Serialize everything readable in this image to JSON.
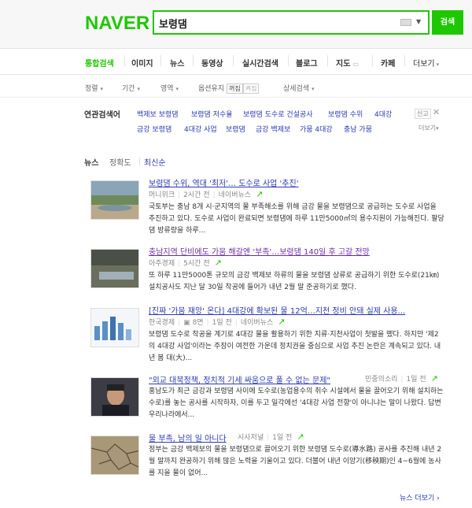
{
  "header": {
    "logo": "NAVER",
    "query": "보령댐",
    "search_button": "검색"
  },
  "tabs": [
    "통합검색",
    "이미지",
    "뉴스",
    "동영상",
    "실시간검색",
    "블로그",
    "지도",
    "카페",
    "더보기"
  ],
  "filters": {
    "sort": "정렬",
    "period": "기간",
    "area": "영역",
    "option_keep": "옵션유지",
    "toggle_on": "꺼짐",
    "toggle_off": "켜짐",
    "detail": "상세검색"
  },
  "related": {
    "title": "연관검색어",
    "report": "신고",
    "more": "더보기",
    "row1": [
      "백제보 보령댐",
      "보령댐 저수율",
      "보령댐 도수로 건설공사",
      "보령댐 수위",
      "4대강"
    ],
    "row2": [
      "금강 보령댐",
      "4대강 사업",
      "보령댐",
      "금강 백제보",
      "가뭄 4대강",
      "충남 가뭄"
    ]
  },
  "sort_tabs": [
    "뉴스",
    "정확도",
    "최신순"
  ],
  "news": [
    {
      "title": "보령댐 수위, 역대 '최저'… 도수로 사업 '추진'",
      "source": "머니위크",
      "time": "2시간 전",
      "link": "네이버뉴스",
      "snippet": "국토부는 충남 8개 시·군지역의 물 부족해소를 위해 금강 물을 보령댐으로 공급하는 도수로 사업을 추진하고 있다. 도수로 사업이 완료되면 보령댐에 하루 11만5000㎥의 용수지원이 가능해진다. 팔당댐 방류량을 하루..."
    },
    {
      "title": "충남지역 단비에도 가뭄 해갈엔 '부족'…보령댐 140일 후 고갈 전망",
      "source": "아주경제",
      "time": "5시간 전",
      "link": "",
      "snippet": "또 하루 11만5000톤 규모의 금강 백제보 하류의 물을 보령댐 상류로 공급하기 위한 도수로(21㎞) 설치공사도 지난 달 30일 착공에 들어가 내년 2월 말 준공하기로 했다."
    },
    {
      "title": "[진짜 '가뭄 재앙' 온다] 4대강에 확보된 물 12억…지천 정비 안돼 실제 사용...",
      "source": "한국경제",
      "extra": "8면",
      "time": "1일 전",
      "link": "네이버뉴스",
      "snippet": "보령댐 도수로 착공을 계기로 4대강 물을 활용하기 위한 지류·지천사업이 첫발을 뗐다. 하지만 '제2의 4대강 사업'이라는 주장이 여전한 가운데 정치권을 중심으로 사업 추진 논란은 계속되고 있다. 내년 봄 대(大)..."
    },
    {
      "title": "\"외교 대북정책, 정치적 기세 싸움으로 풀 수 없는 문제\"",
      "source": "민중의소리",
      "time": "1일 전",
      "link": "",
      "snippet": "홍남도가 최근 금강과 보령댐 사이에 도수로(농업용수의 취수 시설에서 물을 끌어오기 위해 설치하는 수로)를 놓는 공사를 시작하자, 이를 두고 일각에선 '4대강 사업 전향'이 아니냐는 말이 나왔다. 답변 우리나라에서..."
    },
    {
      "title": "물 부족, 남의 일 아니다",
      "source": "시사저널",
      "time": "1일 전",
      "link": "",
      "snippet": "정부는 금강 백제보의 물을 보령댐으로 끌어오기 위한 보령댐 도수로(導水路) 공사를 추진해 내년 2월 말까지 완공하기 위해 많은 노력을 기울이고 있다. 더불어 내년 이앙기(移秧期)인 4~6월에 농사를 지을 물이 없어..."
    }
  ],
  "more_news": "뉴스 더보기"
}
